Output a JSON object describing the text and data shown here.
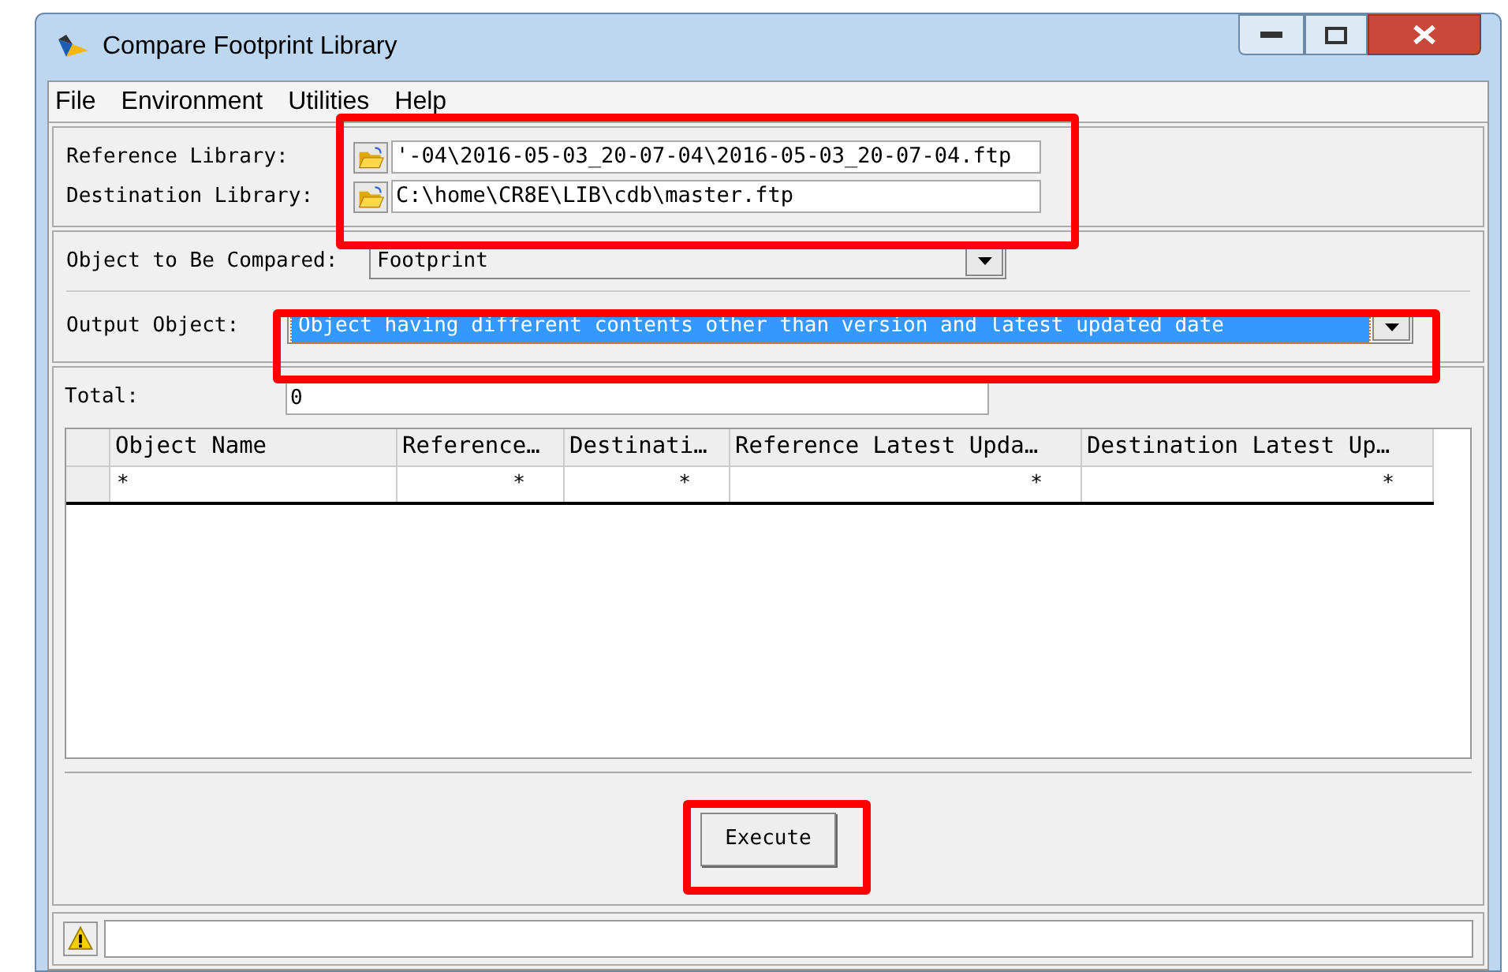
{
  "window": {
    "title": "Compare Footprint Library"
  },
  "menu": [
    "File",
    "Environment",
    "Utilities",
    "Help"
  ],
  "libraries": [
    {
      "label": "Reference Library:",
      "value": "'-04\\2016-05-03_20-07-04\\2016-05-03_20-07-04.ftp"
    },
    {
      "label": "Destination Library:",
      "value": "C:\\home\\CR8E\\LIB\\cdb\\master.ftp"
    }
  ],
  "object_to_compare": {
    "label": "Object to Be Compared:",
    "value": "Footprint",
    "selected": false
  },
  "output_object": {
    "label": "Output Object:",
    "value": "Object having different contents other than version and latest updated date",
    "selected": true
  },
  "total": {
    "label": "Total:",
    "value": "0"
  },
  "table": {
    "columns": [
      "Object Name",
      "Reference…",
      "Destinati…",
      "Reference Latest Upda…",
      "Destination Latest Up…"
    ],
    "rows": [
      [
        "*",
        "*",
        "*",
        "*",
        "*"
      ]
    ]
  },
  "execute_button": "Execute"
}
